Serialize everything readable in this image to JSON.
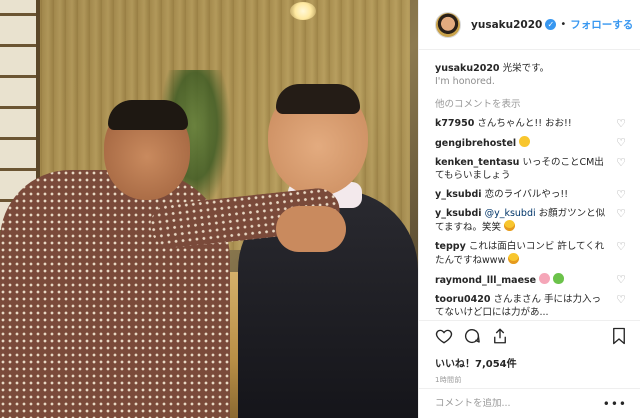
{
  "post": {
    "username": "yusaku2020",
    "verified_mark": "✓",
    "separator": "•",
    "follow_label": "フォローする"
  },
  "caption": {
    "username": "yusaku2020",
    "text": "光栄です。",
    "subtext": "I'm honored."
  },
  "load_more_label": "他のコメントを表示",
  "comments": [
    {
      "username": "k77950",
      "text": "さんちゃんと!! おお!!",
      "emoji": ""
    },
    {
      "username": "gengibrehostel",
      "text": "",
      "emoji": "smile"
    },
    {
      "username": "kenken_tentasu",
      "text": "いっそのことCM出てもらいましょう",
      "emoji": ""
    },
    {
      "username": "y_ksubdi",
      "text": "恋のライバルやっ!!",
      "emoji": ""
    },
    {
      "username": "y_ksubdi",
      "mention": "@y_ksubdi",
      "text": "お顔ガツンと似てますね。笑笑",
      "emoji": "laugh"
    },
    {
      "username": "teppy",
      "text": "これは面白いコンビ 許してくれたんですねwww",
      "emoji": "laugh"
    },
    {
      "username": "raymond_lll_maese",
      "text": "",
      "emoji": "pig-alien"
    },
    {
      "username": "tooru0420",
      "text": "さんまさん 手には力入ってないけど口には力があ...",
      "emoji": ""
    }
  ],
  "likes_text": "いいね！7,054件",
  "time_text": "1時間前",
  "add_comment_placeholder": "コメントを追加...",
  "more_options": "•••",
  "icons": {
    "like": "heart-icon",
    "comment": "comment-icon",
    "share": "share-icon",
    "save": "bookmark-icon"
  },
  "colors": {
    "accent": "#3897f0",
    "text": "#262626",
    "muted": "#999999",
    "border": "#efefef"
  }
}
